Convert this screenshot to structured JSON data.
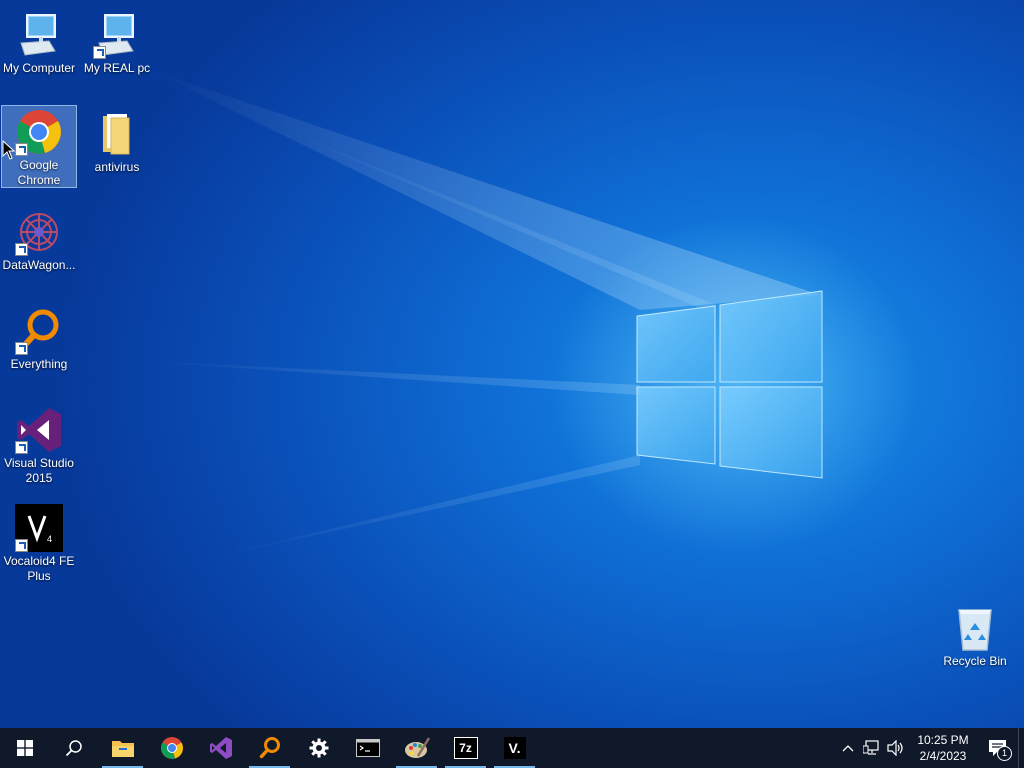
{
  "desktop": {
    "icons": [
      {
        "label": "My Computer",
        "icon": "monitor-icon"
      },
      {
        "label": "My REAL pc",
        "icon": "monitor-icon"
      },
      {
        "label": "Google Chrome",
        "icon": "chrome-icon"
      },
      {
        "label": "antivirus",
        "icon": "folder-icon"
      },
      {
        "label": "DataWagon...",
        "icon": "datawagon-icon"
      },
      {
        "label": "Everything",
        "icon": "magnifier-icon"
      },
      {
        "label": "Visual Studio 2015",
        "icon": "visual-studio-icon"
      },
      {
        "label": "Vocaloid4 FE Plus",
        "icon": "vocaloid-icon"
      },
      {
        "label": "Recycle Bin",
        "icon": "recycle-bin-icon"
      }
    ]
  },
  "taskbar": {
    "buttons": [
      {
        "name": "Start",
        "icon": "windows-logo-icon"
      },
      {
        "name": "Search",
        "icon": "search-icon"
      },
      {
        "name": "File Explorer",
        "icon": "folder-icon"
      },
      {
        "name": "Google Chrome",
        "icon": "chrome-icon"
      },
      {
        "name": "Visual Studio 2015",
        "icon": "visual-studio-icon"
      },
      {
        "name": "Everything",
        "icon": "magnifier-icon"
      },
      {
        "name": "Settings",
        "icon": "gear-icon"
      },
      {
        "name": "Command Prompt",
        "icon": "terminal-icon"
      },
      {
        "name": "Paint",
        "icon": "palette-icon"
      },
      {
        "name": "7-Zip",
        "icon": "7zip-icon"
      },
      {
        "name": "Vocaloid",
        "icon": "vocaloid-icon"
      }
    ],
    "seven_zip_text": "7z",
    "vocaloid_text": "V."
  },
  "tray": {
    "time": "10:25 PM",
    "date": "2/4/2023",
    "notification_count": "1"
  },
  "colors": {
    "taskbar": "#10192a",
    "accent": "#76b9ed",
    "desktop_blue": "#0f6fd6"
  }
}
